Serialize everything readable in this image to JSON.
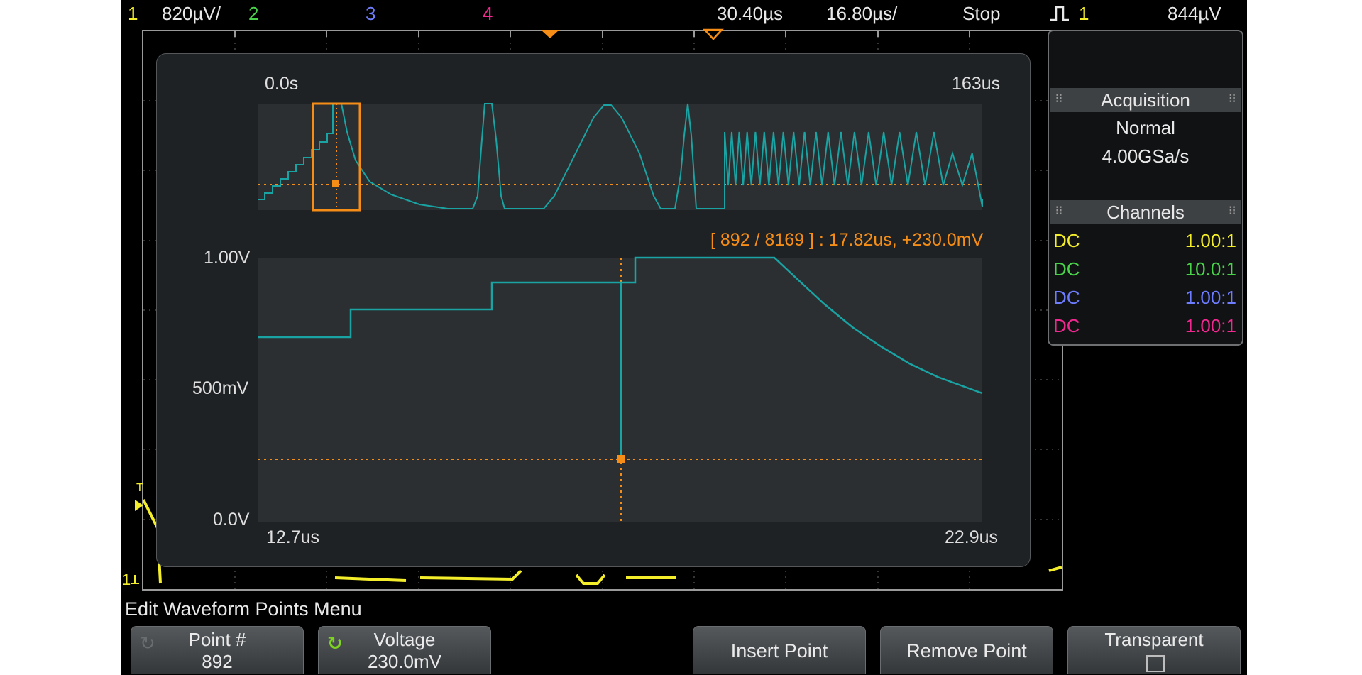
{
  "status_bar": {
    "ch1_num": "1",
    "ch1_scale": "820µV/",
    "ch2_num": "2",
    "ch3_num": "3",
    "ch4_num": "4",
    "time_delay": "30.40µs",
    "time_scale": "16.80µs/",
    "run_state": "Stop",
    "trigger_icon": "rising-edge-trigger-icon",
    "trigger_source": "1",
    "trigger_level": "844µV"
  },
  "editor": {
    "overview_start": "0.0s",
    "overview_end": "163us",
    "readout": "[ 892 / 8169 ] : 17.82us, +230.0mV",
    "y_top": "1.00V",
    "y_mid": "500mV",
    "y_bottom": "0.0V",
    "zoom_start": "12.7us",
    "zoom_end": "22.9us",
    "point_index": 892,
    "point_total": 8169,
    "point_time_us": 17.82,
    "point_voltage_mv": 230.0
  },
  "side_panel": {
    "acquisition_title": "Acquisition",
    "acq_mode": "Normal",
    "acq_rate": "4.00GSa/s",
    "channels_title": "Channels",
    "channels": [
      {
        "coupling": "DC",
        "atten": "1.00:1",
        "color": "#f4ee2a"
      },
      {
        "coupling": "DC",
        "atten": "10.0:1",
        "color": "#49d34a"
      },
      {
        "coupling": "DC",
        "atten": "1.00:1",
        "color": "#6e7cff"
      },
      {
        "coupling": "DC",
        "atten": "1.00:1",
        "color": "#f0288f"
      }
    ]
  },
  "menu": {
    "title": "Edit Waveform Points Menu",
    "point_label": "Point #",
    "point_value": "892",
    "voltage_label": "Voltage",
    "voltage_value": "230.0mV",
    "insert_label": "Insert Point",
    "remove_label": "Remove Point",
    "transparent_label": "Transparent"
  },
  "colors": {
    "waveform": "#1aa3a3",
    "cursor": "#f58d16",
    "ch1": "#f4ee2a"
  }
}
